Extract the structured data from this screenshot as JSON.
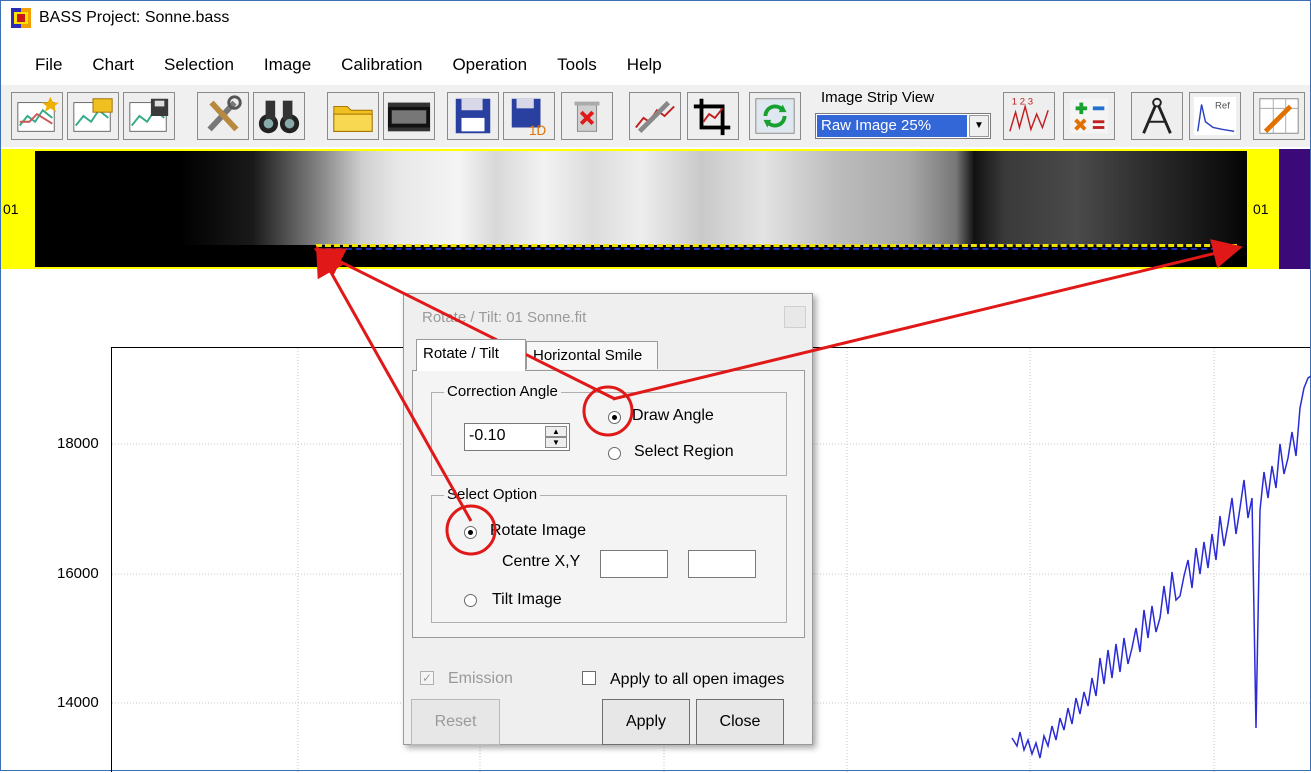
{
  "window": {
    "title": "BASS Project: Sonne.bass"
  },
  "menu": [
    "File",
    "Chart",
    "Selection",
    "Image",
    "Calibration",
    "Operation",
    "Tools",
    "Help"
  ],
  "toolbar": {
    "image_strip_label": "Image Strip View",
    "image_strip_value": "Raw Image 25%",
    "one_d_badge": "1D",
    "ref_badge": "Ref",
    "numbers_badge": "1 2 3"
  },
  "strip": {
    "left_label": "01",
    "right_label": "01"
  },
  "chart": {
    "y_ticks": [
      "18000",
      "16000",
      "14000"
    ]
  },
  "dialog": {
    "title": "Rotate / Tilt: 01 Sonne.fit",
    "tabs": [
      "Rotate / Tilt",
      "Horizontal Smile"
    ],
    "correction_angle": {
      "legend": "Correction Angle",
      "value": "-0.10",
      "options": [
        "Draw Angle",
        "Select Region"
      ],
      "selected": "Draw Angle"
    },
    "select_option": {
      "legend": "Select Option",
      "options": [
        "Rotate Image",
        "Tilt Image"
      ],
      "selected": "Rotate Image",
      "centre_label": "Centre X,Y",
      "centre_x": "",
      "centre_y": ""
    },
    "emission_label": "Emission",
    "emission_checked": true,
    "apply_all_label": "Apply to all open images",
    "apply_all_checked": false,
    "buttons": {
      "reset": "Reset",
      "apply": "Apply",
      "close": "Close"
    }
  },
  "colors": {
    "annotation": "#e01818",
    "selection": "#3366d6",
    "plot_line": "#2a2ad8",
    "strip_bg": "#ffff00"
  }
}
